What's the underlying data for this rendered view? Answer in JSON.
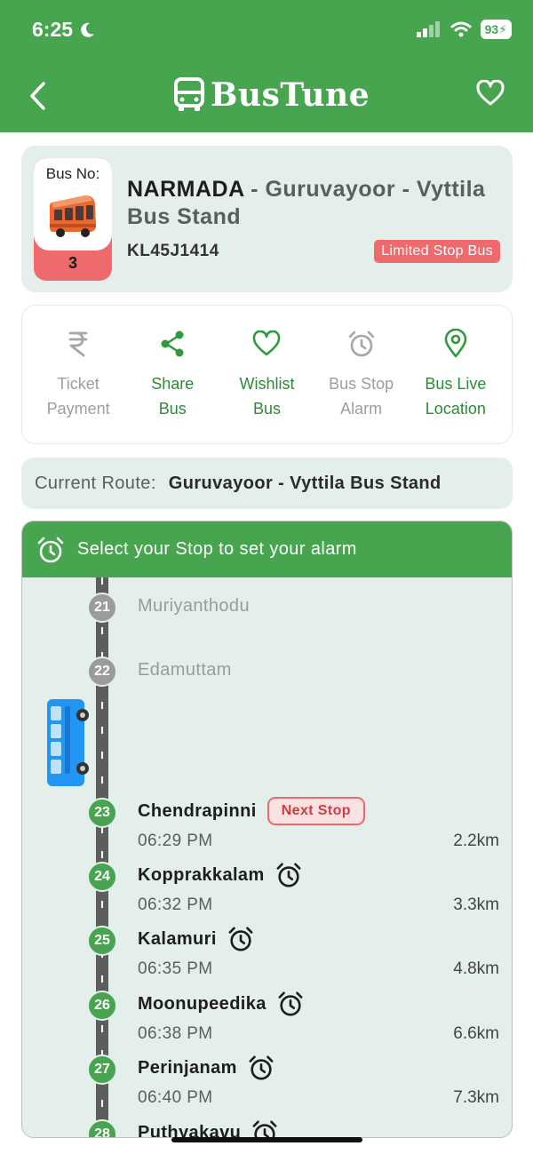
{
  "status_bar": {
    "time": "6:25",
    "battery": "93"
  },
  "header": {
    "brand": "BusTune"
  },
  "bus": {
    "label": "Bus No:",
    "number": "3",
    "name": "NARMADA",
    "separator": " - ",
    "route": "Guruvayoor - Vyttila Bus Stand",
    "registration": "KL45J1414",
    "type": "Limited Stop Bus"
  },
  "actions": [
    {
      "line1": "Ticket",
      "line2": "Payment",
      "icon": "rupee-icon",
      "enabled": false
    },
    {
      "line1": "Share",
      "line2": "Bus",
      "icon": "share-icon",
      "enabled": true
    },
    {
      "line1": "Wishlist",
      "line2": "Bus",
      "icon": "heart-icon",
      "enabled": true
    },
    {
      "line1": "Bus Stop",
      "line2": "Alarm",
      "icon": "alarm-icon",
      "enabled": false
    },
    {
      "line1": "Bus Live",
      "line2": "Location",
      "icon": "location-pin-icon",
      "enabled": true
    }
  ],
  "current_route": {
    "label": "Current Route:",
    "value": "Guruvayoor - Vyttila Bus Stand"
  },
  "stops_panel": {
    "title": "Select your Stop to set your alarm"
  },
  "stops": [
    {
      "num": "21",
      "name": "Muriyanthodu",
      "status": "passed"
    },
    {
      "num": "22",
      "name": "Edamuttam",
      "status": "passed"
    },
    {
      "num": "23",
      "name": "Chendrapinni",
      "time": "06:29 PM",
      "distance": "2.2km",
      "badge": "Next Stop",
      "status": "next"
    },
    {
      "num": "24",
      "name": "Kopprakkalam",
      "time": "06:32 PM",
      "distance": "3.3km",
      "status": "upcoming"
    },
    {
      "num": "25",
      "name": "Kalamuri",
      "time": "06:35 PM",
      "distance": "4.8km",
      "status": "upcoming"
    },
    {
      "num": "26",
      "name": "Moonupeedika",
      "time": "06:38 PM",
      "distance": "6.6km",
      "status": "upcoming"
    },
    {
      "num": "27",
      "name": "Perinjanam",
      "time": "06:40 PM",
      "distance": "7.3km",
      "status": "upcoming"
    },
    {
      "num": "28",
      "name": "Puthyakavu",
      "status": "upcoming"
    }
  ],
  "colors": {
    "primary": "#47a550",
    "accent": "#ee6a6d",
    "card": "#e4eeeb"
  }
}
